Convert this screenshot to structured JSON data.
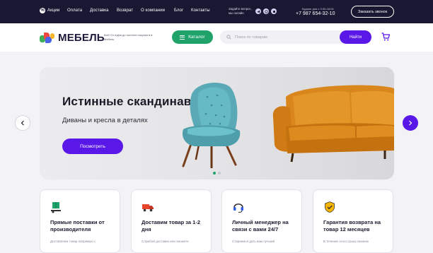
{
  "topbar": {
    "promo_icon": "percent-icon",
    "links": [
      "Акции",
      "Оплата",
      "Доставка",
      "Возврат",
      "О компании",
      "Блог",
      "Контакты"
    ],
    "ask_text": "Задайте вопрос, мы онлайн",
    "socials": [
      "telegram-icon",
      "viber-icon",
      "vk-icon"
    ],
    "hours": "Будние дни с 9:00-18:00",
    "phone": "+7 987 654-32-10",
    "callback": "Заказать звонок"
  },
  "header": {
    "logo_text": "МЕБЕЛЬ",
    "tagline": "Всё! От пуфа до постели покупки в в Мебель",
    "catalog": "Каталог",
    "search_placeholder": "Поиск по товарам",
    "search_button": "Найти"
  },
  "hero": {
    "title": "Истинные скандинавы",
    "subtitle": "Диваны и кресла в деталях",
    "button": "Посмотреть",
    "slides": 2,
    "active_slide": 1
  },
  "features": [
    {
      "icon": "truck-box-icon",
      "title": "Прямые поставки от производителя",
      "text": "Доставляем товар напрямую с"
    },
    {
      "icon": "delivery-truck-icon",
      "title": "Доставим товар за 1-2 дня",
      "text": "Службой доставки или сможете"
    },
    {
      "icon": "headset-icon",
      "title": "Личный менеджер на связи с вами 24/7",
      "text": "Стараемся дать вам лучший"
    },
    {
      "icon": "shield-check-icon",
      "title": "Гарантия возврата на товар 12 месяцев",
      "text": "В течение этого срока сможем"
    }
  ],
  "colors": {
    "topbar_bg": "#191731",
    "accent_purple": "#5a18e8",
    "accent_green": "#1fa36a",
    "page_bg": "#f3f3f6"
  }
}
